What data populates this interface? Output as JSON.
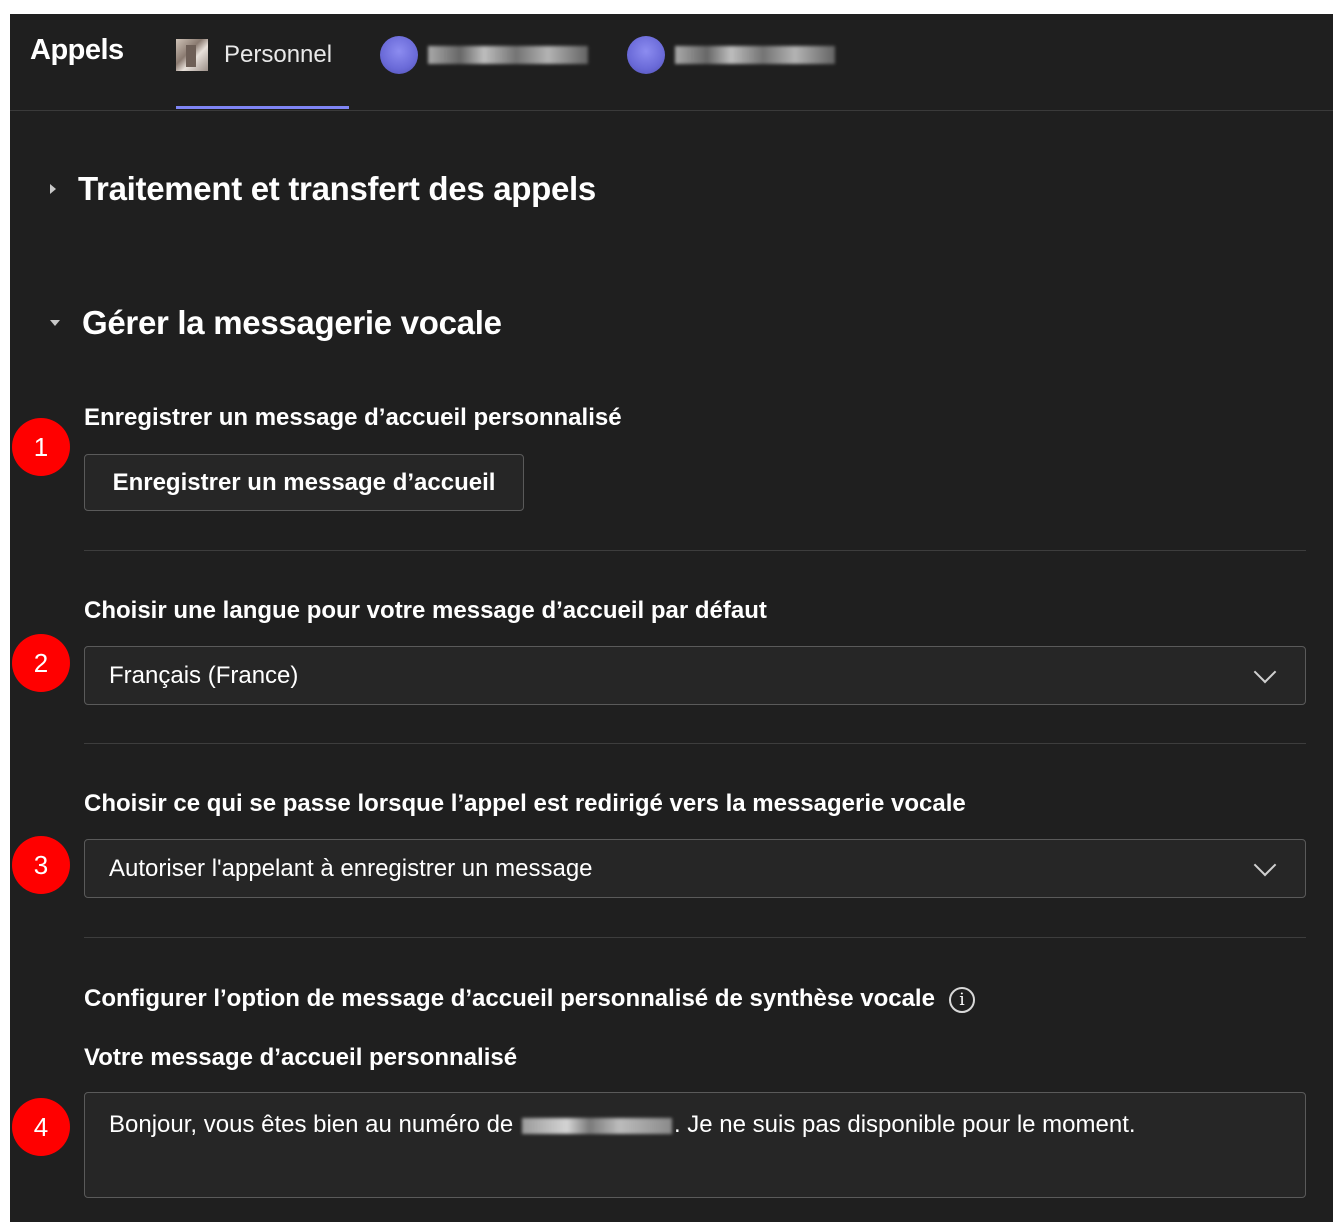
{
  "header": {
    "app_title": "Appels",
    "tabs": [
      {
        "label": "Personnel",
        "active": true
      },
      {
        "label": "",
        "redacted": true
      },
      {
        "label": "",
        "redacted": true
      }
    ]
  },
  "sections": {
    "call_handling": {
      "title": "Traitement et transfert des appels",
      "expanded": false
    },
    "voicemail": {
      "title": "Gérer la messagerie vocale",
      "expanded": true,
      "record_greeting": {
        "label": "Enregistrer un message d’accueil personnalisé",
        "button_label": "Enregistrer un message d’accueil"
      },
      "greeting_language": {
        "label": "Choisir une langue pour votre message d’accueil par défaut",
        "selected": "Français (France)"
      },
      "redirect_action": {
        "label": "Choisir ce qui se passe lorsque l’appel est redirigé vers la messagerie vocale",
        "selected": "Autoriser l'appelant à enregistrer un message"
      },
      "tts_greeting": {
        "label": "Configurer l’option de message d’accueil personnalisé de synthèse vocale",
        "info_glyph": "i",
        "message_label": "Votre message d’accueil personnalisé",
        "message_prefix": "Bonjour, vous êtes bien au numéro de",
        "message_suffix": ". Je ne suis pas disponible pour le moment."
      }
    }
  },
  "annotations": [
    "1",
    "2",
    "3",
    "4"
  ],
  "colors": {
    "background": "#1f1f1f",
    "accent": "#7f85f5",
    "annotation": "#ff0000"
  },
  "icons": {
    "expand_caret": "caret-right-icon",
    "collapse_caret": "caret-down-icon",
    "dropdown": "chevron-down-icon",
    "info": "info-icon"
  }
}
